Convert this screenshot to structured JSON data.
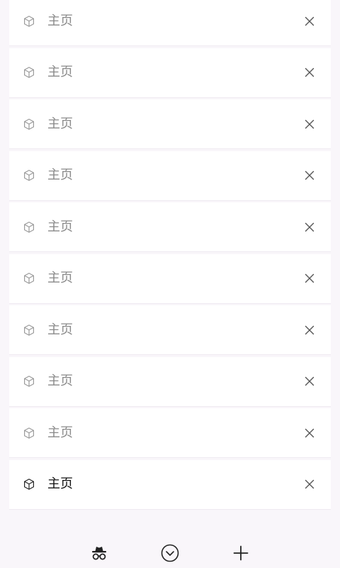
{
  "tabs": [
    {
      "title": "主页",
      "active": false
    },
    {
      "title": "主页",
      "active": false
    },
    {
      "title": "主页",
      "active": false
    },
    {
      "title": "主页",
      "active": false
    },
    {
      "title": "主页",
      "active": false
    },
    {
      "title": "主页",
      "active": false
    },
    {
      "title": "主页",
      "active": false
    },
    {
      "title": "主页",
      "active": false
    },
    {
      "title": "主页",
      "active": false
    },
    {
      "title": "主页",
      "active": true
    }
  ],
  "icons": {
    "tab": "cube-icon",
    "close": "close-icon",
    "incognito": "incognito-icon",
    "collapse": "chevron-down-circle-icon",
    "new_tab": "plus-icon"
  },
  "colors": {
    "background": "#f9f6fa",
    "card": "#ffffff",
    "inactive_text": "#8a8a8a",
    "active_text": "#111111",
    "icon_gray": "#9a9a9a",
    "icon_dark": "#222222"
  }
}
